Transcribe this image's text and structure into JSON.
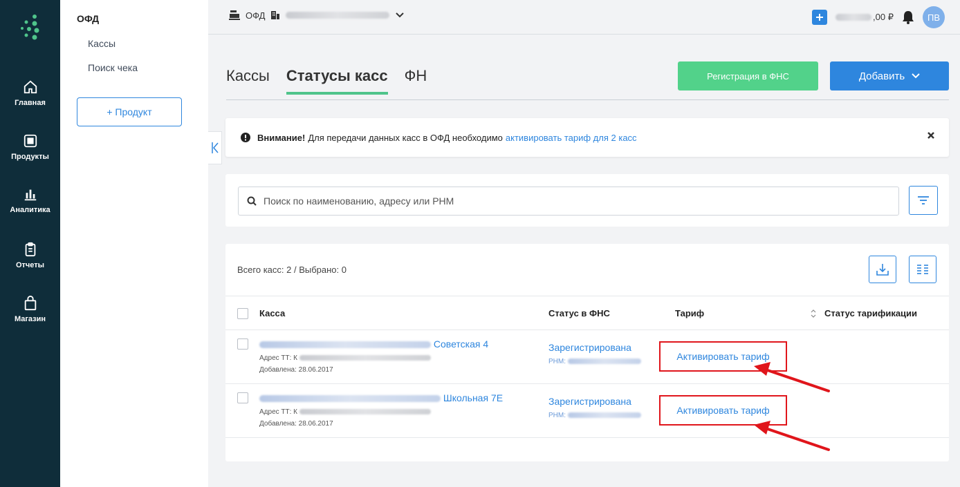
{
  "rail": {
    "items": [
      {
        "label": "Главная",
        "icon": "home-icon"
      },
      {
        "label": "Продукты",
        "icon": "grid-icon"
      },
      {
        "label": "Аналитика",
        "icon": "chart-icon"
      },
      {
        "label": "Отчеты",
        "icon": "clipboard-icon"
      },
      {
        "label": "Магазин",
        "icon": "bag-icon"
      }
    ]
  },
  "subside": {
    "title": "ОФД",
    "links": [
      "Кассы",
      "Поиск чека"
    ],
    "product_button": "+ Продукт"
  },
  "topbar": {
    "ofd_label": "ОФД",
    "balance_suffix": ",00 ₽",
    "avatar_initials": "ПВ"
  },
  "tabs": [
    "Кассы",
    "Статусы касс",
    "ФН"
  ],
  "actions": {
    "register_fns": "Регистрация в ФНС",
    "add": "Добавить"
  },
  "alert": {
    "bold": "Внимание!",
    "text": "Для передачи данных касс в ОФД необходимо",
    "link": "активировать тариф для 2 касс"
  },
  "search": {
    "placeholder": "Поиск по наименованию, адресу или РНМ"
  },
  "table": {
    "count_line": "Всего касс: 2  /  Выбрано: 0",
    "headers": {
      "kassa": "Касса",
      "status": "Статус в ФНС",
      "tariff": "Тариф",
      "tariff_status": "Статус тарификации"
    },
    "rows": [
      {
        "name_suffix": "Советская 4",
        "address_label": "Адрес ТТ: К",
        "added": "Добавлена: 28.06.2017",
        "status": "Зарегистрирована",
        "rnm_label": "РНМ:",
        "tariff_action": "Активировать тариф"
      },
      {
        "name_suffix": "Школьная 7Е",
        "address_label": "Адрес ТТ: К",
        "added": "Добавлена: 28.06.2017",
        "status": "Зарегистрирована",
        "rnm_label": "РНМ:",
        "tariff_action": "Активировать тариф"
      }
    ]
  },
  "colors": {
    "rail_bg": "#0f2d3a",
    "accent_blue": "#2e86de",
    "accent_green": "#52d28a",
    "highlight_red": "#e0151b"
  }
}
